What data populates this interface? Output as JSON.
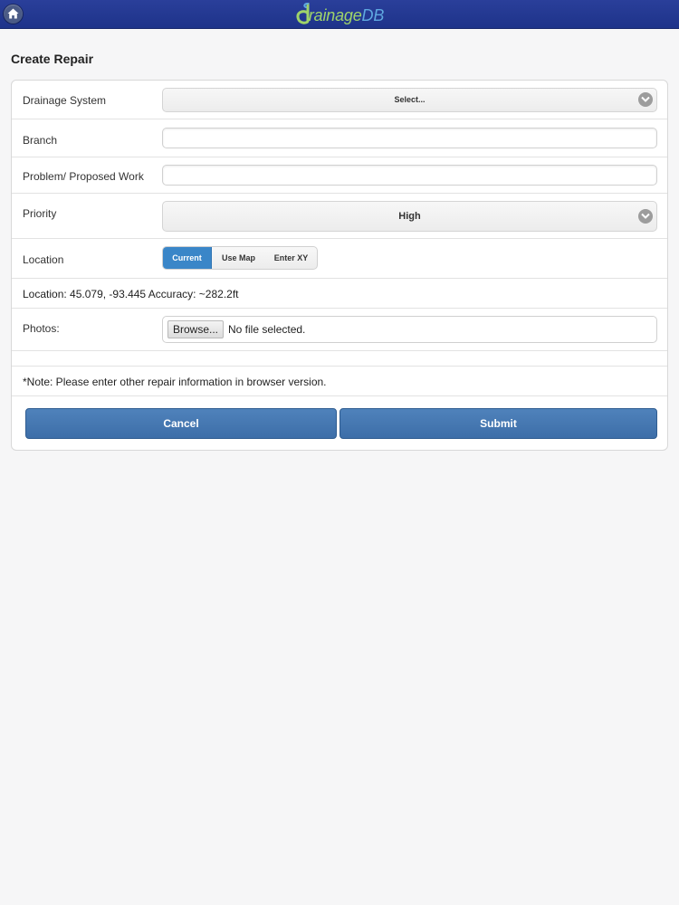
{
  "header": {
    "logo_word_part1": "rainage",
    "logo_word_part2": "DB",
    "home_icon": "home-icon"
  },
  "page": {
    "title": "Create Repair"
  },
  "form": {
    "drainage_system": {
      "label": "Drainage System",
      "selected": "Select..."
    },
    "branch": {
      "label": "Branch",
      "value": ""
    },
    "problem": {
      "label": "Problem/ Proposed Work",
      "value": ""
    },
    "priority": {
      "label": "Priority",
      "selected": "High"
    },
    "location": {
      "label": "Location",
      "modes": [
        "Current",
        "Use Map",
        "Enter XY"
      ],
      "active_mode": "Current",
      "readout": "Location: 45.079, -93.445 Accuracy: ~282.2ft"
    },
    "photos": {
      "label": "Photos:",
      "browse_label": "Browse...",
      "file_status": "No file selected."
    },
    "note": "*Note: Please enter other repair information in browser version.",
    "cancel_label": "Cancel",
    "submit_label": "Submit"
  },
  "colors": {
    "header_bg": "#1e338a",
    "active_segment": "#3a86c8",
    "button_bg": "#4577b1",
    "logo_green": "#9fd36a",
    "logo_blue": "#5fa8e0"
  }
}
